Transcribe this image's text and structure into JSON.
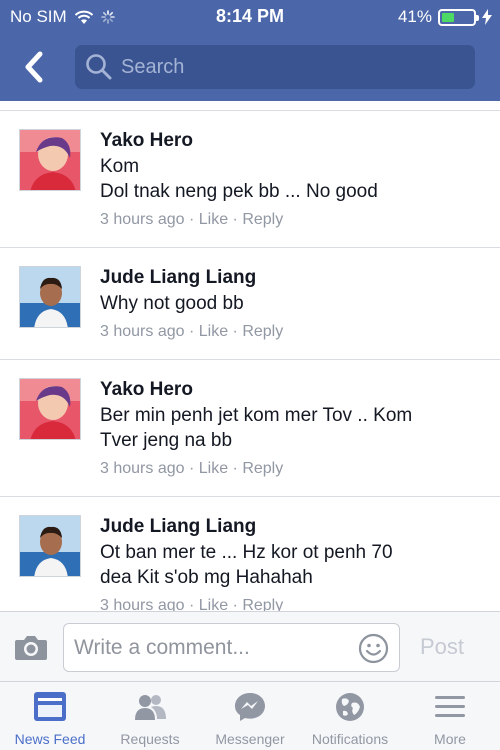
{
  "status_bar": {
    "carrier": "No SIM",
    "time": "8:14 PM",
    "battery_text": "41%",
    "battery_level": 0.41
  },
  "search": {
    "placeholder": "Search"
  },
  "comments": [
    {
      "name": "Yako Hero",
      "lines": [
        "Kom",
        "Dol tnak neng pek bb ... No good"
      ],
      "time": "3 hours ago",
      "like": "Like",
      "reply": "Reply"
    },
    {
      "name": "Jude Liang Liang",
      "lines": [
        "Why not good bb"
      ],
      "time": "3 hours ago",
      "like": "Like",
      "reply": "Reply"
    },
    {
      "name": "Yako Hero",
      "lines": [
        "Ber min penh jet kom mer Tov .. Kom",
        "Tver jeng na bb"
      ],
      "time": "3 hours ago",
      "like": "Like",
      "reply": "Reply"
    },
    {
      "name": "Jude Liang Liang",
      "lines": [
        "Ot ban mer te ... Hz kor ot  penh 70",
        "dea Kit s'ob mg Hahahah"
      ],
      "time": "3 hours ago",
      "like": "Like",
      "reply": "Reply"
    }
  ],
  "composer": {
    "placeholder": "Write a comment...",
    "post_label": "Post"
  },
  "tabs": [
    {
      "label": "News Feed",
      "icon": "news-feed-icon",
      "active": true
    },
    {
      "label": "Requests",
      "icon": "requests-icon"
    },
    {
      "label": "Messenger",
      "icon": "messenger-icon"
    },
    {
      "label": "Notifications",
      "icon": "notifications-icon"
    },
    {
      "label": "More",
      "icon": "more-icon"
    }
  ],
  "colors": {
    "header": "#4b67a9",
    "search_field": "#3a5491",
    "active_tab": "#4b6fc9",
    "inactive_tab": "#9197a3",
    "battery": "#4cd964"
  }
}
